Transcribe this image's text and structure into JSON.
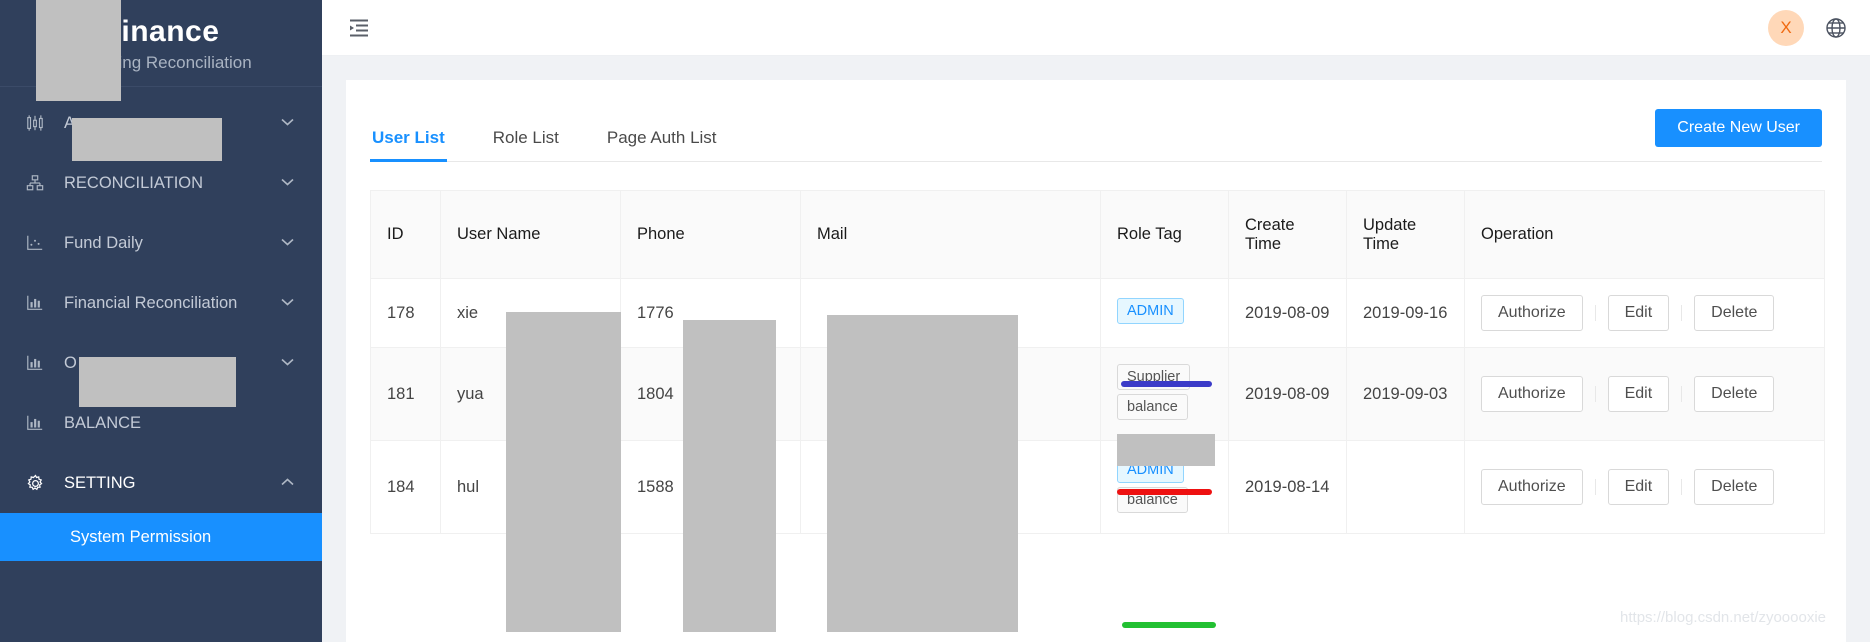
{
  "brand": {
    "title": "Finance",
    "subtitle": "Accounting Reconciliation",
    "title_visible_fragment": "Finance",
    "subtitle_visible_fragment": "A        ounting Reconciliation"
  },
  "sidebar": {
    "items": [
      {
        "label": "A",
        "icon": "sliders-icon",
        "arrow": "chevron-down-icon",
        "redacted": true
      },
      {
        "label": "RECONCILIATION",
        "icon": "sitemap-icon",
        "arrow": "chevron-down-icon",
        "redacted": false
      },
      {
        "label": "Fund Daily",
        "icon": "scatter-chart-icon",
        "arrow": "chevron-down-icon",
        "redacted": false
      },
      {
        "label": "Financial Reconciliation",
        "icon": "bar-chart-icon",
        "arrow": "chevron-down-icon",
        "redacted": false
      },
      {
        "label": "O",
        "icon": "bar-chart-icon",
        "arrow": "chevron-down-icon",
        "redacted": true
      },
      {
        "label": "BALANCE",
        "icon": "bar-chart-icon",
        "arrow": "",
        "redacted": false
      },
      {
        "label": "SETTING",
        "icon": "gear-icon",
        "arrow": "chevron-up-icon",
        "redacted": false
      }
    ],
    "submenu": {
      "label": "System Permission",
      "active": true
    }
  },
  "topbar": {
    "collapse_icon": "menu-collapse-icon",
    "avatar_initial": "X",
    "language_icon": "globe-icon"
  },
  "main": {
    "tabs": [
      {
        "label": "User List",
        "selected": true
      },
      {
        "label": "Role List",
        "selected": false
      },
      {
        "label": "Page Auth List",
        "selected": false
      }
    ],
    "create_button": "Create New User",
    "table": {
      "columns": [
        "ID",
        "User Name",
        "Phone",
        "Mail",
        "Role Tag",
        "Create Time",
        "Update Time",
        "Operation"
      ],
      "rows": [
        {
          "id": "178",
          "user_name": "xie",
          "phone": "1776",
          "mail": "",
          "role_tags": [
            {
              "text": "ADMIN",
              "style": "admin"
            }
          ],
          "create_time": "2019-08-09",
          "update_time": "2019-09-16",
          "operations": [
            "Authorize",
            "Edit",
            "Delete"
          ],
          "annotation_color": "#3b3bc8"
        },
        {
          "id": "181",
          "user_name": "yua",
          "phone": "1804",
          "mail": "",
          "role_tags": [
            {
              "text": "Supplier",
              "style": "plain"
            },
            {
              "text": "balance",
              "style": "plain"
            }
          ],
          "create_time": "2019-08-09",
          "update_time": "2019-09-03",
          "operations": [
            "Authorize",
            "Edit",
            "Delete"
          ],
          "annotation_color": "#ee1111"
        },
        {
          "id": "184",
          "user_name": "hul",
          "phone": "1588",
          "mail": "",
          "role_tags": [
            {
              "text": "ADMIN",
              "style": "admin"
            },
            {
              "text": "balance",
              "style": "plain"
            }
          ],
          "create_time": "2019-08-14",
          "update_time": "",
          "operations": [
            "Authorize",
            "Edit",
            "Delete"
          ],
          "annotation_color": "#22c032"
        }
      ]
    }
  },
  "watermark": "https://blog.csdn.net/zyooooxie",
  "colors": {
    "sidebar_bg": "#30405c",
    "accent": "#1890ff",
    "tag_admin_bg": "#e6f7ff",
    "tag_admin_border": "#91d5ff",
    "avatar_bg": "#ffd8b8",
    "avatar_fg": "#f06a12",
    "annotation_blue": "#3b3bc8",
    "annotation_red": "#ee1111",
    "annotation_green": "#22c032",
    "redaction": "#c0c0c0"
  }
}
